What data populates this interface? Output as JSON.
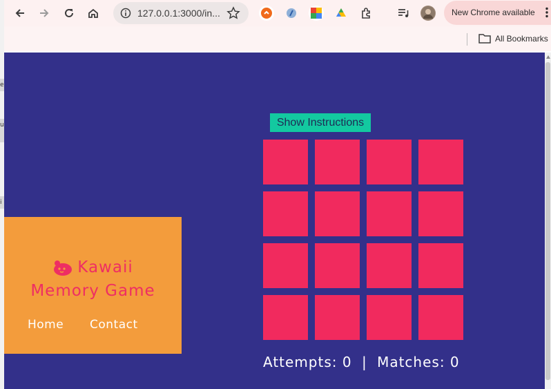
{
  "browser": {
    "url": "127.0.0.1:3000/in...",
    "update_text": "New Chrome available",
    "bookmarks_label": "All Bookmarks",
    "icons": [
      "back-icon",
      "forward-icon",
      "reload-icon",
      "home-icon",
      "site-info-icon",
      "star-icon",
      "extension-icon",
      "reading-list-icon",
      "profile-avatar",
      "menu-dots-icon",
      "folder-icon"
    ]
  },
  "page": {
    "title_line1": "Kawaii",
    "title_line2": "Memory Game",
    "nav": {
      "home": "Home",
      "contact": "Contact"
    },
    "show_instructions": "Show Instructions",
    "attempts_label": "Attempts:",
    "attempts": "0",
    "separator": "|",
    "matches_label": "Matches:",
    "matches": "0",
    "cards_count": 16
  },
  "colors": {
    "page_bg": "#33308a",
    "header_bg": "#f39c3c",
    "title": "#ee2e63",
    "card": "#f12a5e",
    "button": "#13c9a0"
  }
}
